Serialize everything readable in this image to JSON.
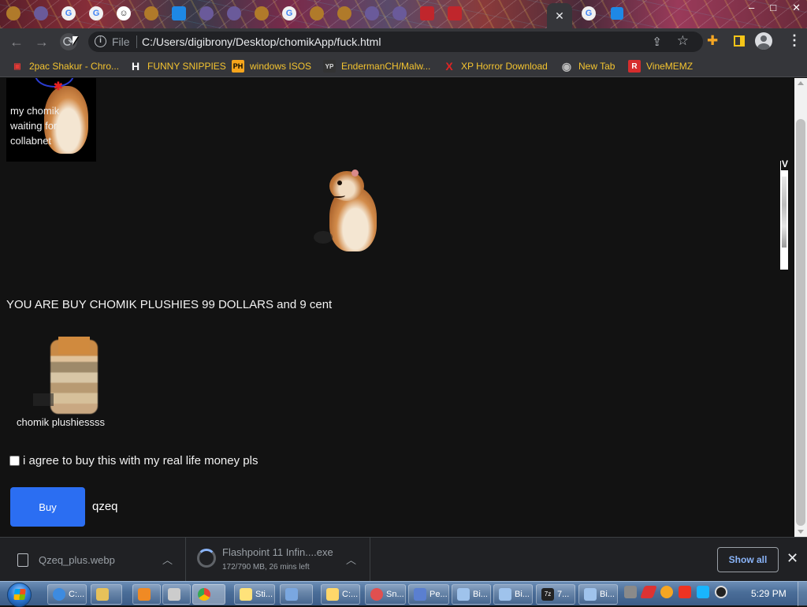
{
  "window": {
    "controls": [
      "–",
      "□",
      "✕"
    ],
    "active_tab_close": "✕"
  },
  "toolbar": {
    "back": "←",
    "forward": "→",
    "reload": "⟳",
    "scheme_label": "File",
    "url": "C:/Users/digibrony/Desktop/chomikApp/fuck.html",
    "share_icon": "⇪",
    "star_icon": "☆",
    "menu_icon": "⋮"
  },
  "bookmarks": [
    {
      "label": "2pac Shakur - Chro...",
      "icon": "bag-icon",
      "glyph": "▣",
      "color": "#e53935"
    },
    {
      "label": "FUNNY SNIPPIES",
      "icon": "h-icon",
      "glyph": "H",
      "color": "#ffffff"
    },
    {
      "label": "windows ISOS",
      "icon": "ph-icon",
      "glyph": "PH",
      "color": "#f7a51c"
    },
    {
      "label": "EndermanCH/Malw...",
      "icon": "yt-icon",
      "glyph": "YP",
      "color": "#a33"
    },
    {
      "label": "XP Horror Download",
      "icon": "x-icon",
      "glyph": "X",
      "color": "#e02424"
    },
    {
      "label": "New Tab",
      "icon": "globe-icon",
      "glyph": "◉",
      "color": "#aaaaaa"
    },
    {
      "label": "VineMEMZ",
      "icon": "r-icon",
      "glyph": "R",
      "color": "#d62d2d"
    }
  ],
  "page": {
    "caption_lines": "my chomik waiting for collabnet",
    "headline": "YOU ARE BUY CHOMIK PLUSHIES 99 DOLLARS and 9 cent",
    "plush_caption": "chomik plushiessss",
    "agree_label": "i agree to buy this with my real life money pls",
    "agree_checked": false,
    "buy_label": "Buy",
    "buy_color": "#2b6ef2",
    "trailing_text": "qzeq",
    "side_letter": "V"
  },
  "downloads": {
    "items": [
      {
        "name": "Qzeq_plus.webp",
        "status": ""
      },
      {
        "name": "Flashpoint 11 Infin....exe",
        "status": "172/790 MB, 26 mins left"
      }
    ],
    "show_all": "Show all",
    "close": "✕"
  },
  "taskbar": {
    "buttons": [
      {
        "label": "C:...",
        "color": "#3d8be0"
      },
      {
        "label": "",
        "color": "#e6c15a"
      },
      {
        "label": "",
        "color": "#f08a24"
      },
      {
        "label": "",
        "color": "#cccccc"
      },
      {
        "label": "",
        "color": "#34a853"
      },
      {
        "label": "Sti...",
        "color": "#ffe27a"
      },
      {
        "label": "",
        "color": "#7aa7e0"
      },
      {
        "label": "C:...",
        "color": "#ffd76a"
      },
      {
        "label": "Sn...",
        "color": "#e05050"
      },
      {
        "label": "Pe...",
        "color": "#5a7fd0"
      },
      {
        "label": "Bi...",
        "color": "#9fc3ec"
      },
      {
        "label": "Bi...",
        "color": "#9fc3ec"
      },
      {
        "label": "7...",
        "color": "#222222"
      },
      {
        "label": "Bi...",
        "color": "#9fc3ec"
      }
    ],
    "clock": "5:29 PM"
  }
}
